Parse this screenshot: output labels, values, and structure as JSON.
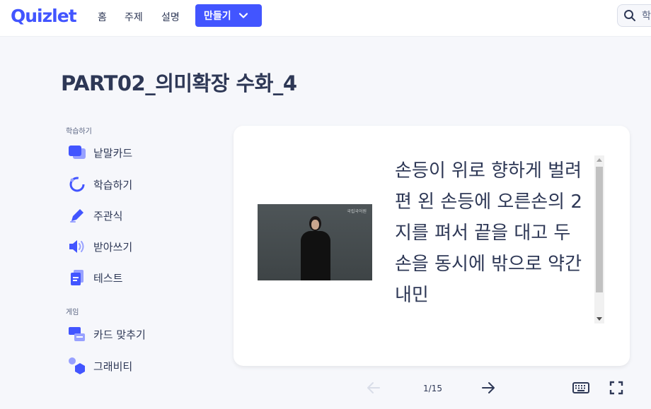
{
  "header": {
    "logo": "Quizlet",
    "nav": [
      "홈",
      "주제",
      "설명"
    ],
    "create_label": "만들기",
    "search_placeholder": "학"
  },
  "title": "PART02_의미확장 수화_4",
  "sidebar": {
    "study_section": "학습하기",
    "study_items": [
      {
        "label": "낱말카드",
        "icon": "flashcards-icon"
      },
      {
        "label": "학습하기",
        "icon": "learn-icon"
      },
      {
        "label": "주관식",
        "icon": "pencil-icon"
      },
      {
        "label": "받아쓰기",
        "icon": "speaker-icon"
      },
      {
        "label": "테스트",
        "icon": "test-icon"
      }
    ],
    "game_section": "게임",
    "game_items": [
      {
        "label": "카드 맞추기",
        "icon": "match-icon"
      },
      {
        "label": "그래비티",
        "icon": "gravity-icon"
      }
    ]
  },
  "card": {
    "definition": "손등이 위로 향하게 벌려 편 왼 손등에 오른손의 2지를 펴서 끝을 대고 두 손을 동시에 밖으로 약간 내민",
    "image_watermark": "국립국어원"
  },
  "controls": {
    "page_counter": "1/15"
  },
  "colors": {
    "brand": "#4255ff",
    "text": "#2e3856",
    "background": "#f6f7fb",
    "icon": "#4255ff"
  }
}
